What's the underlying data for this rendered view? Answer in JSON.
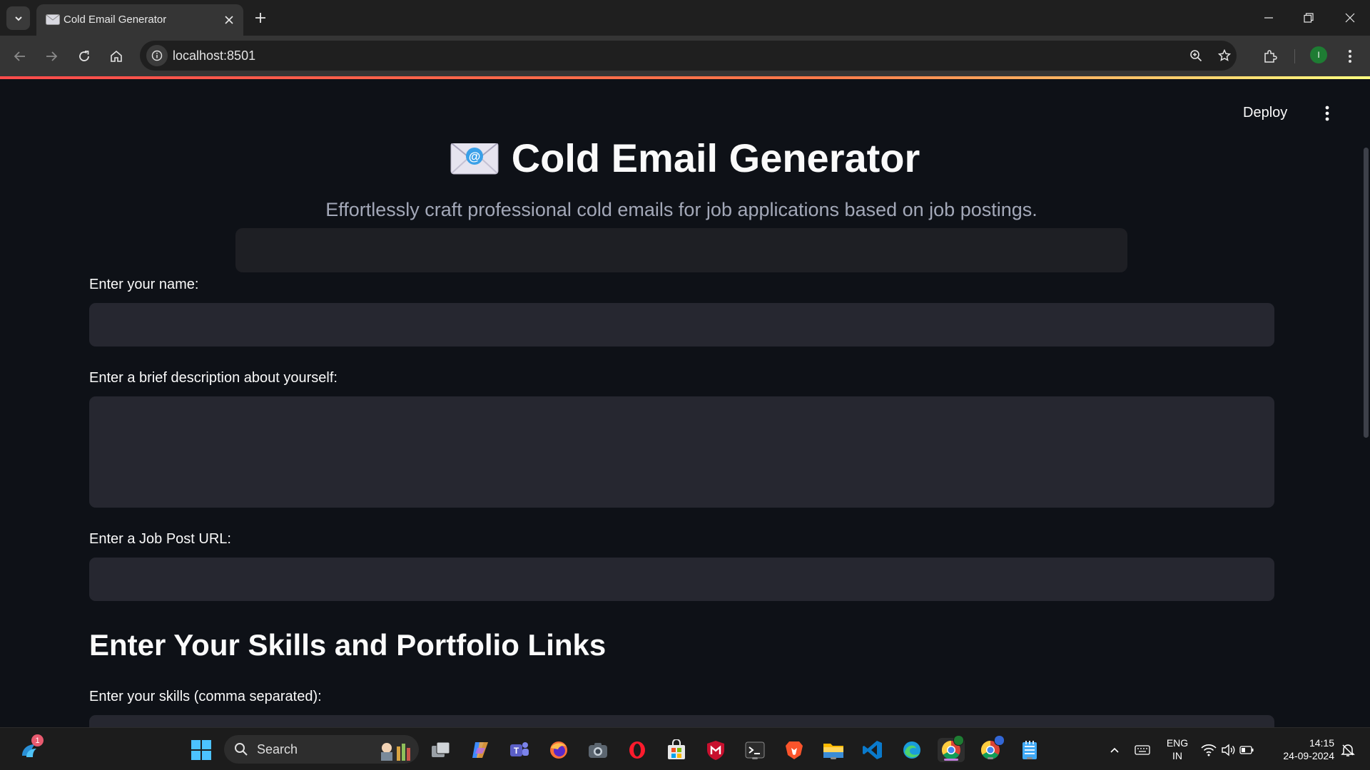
{
  "browser": {
    "tab_title": "Cold Email Generator",
    "url": "localhost:8501",
    "profile_initial": "I"
  },
  "app": {
    "deploy_label": "Deploy",
    "title": "Cold Email Generator",
    "subtitle": "Effortlessly craft professional cold emails for job applications based on job postings.",
    "name_label": "Enter your name:",
    "name_value": "",
    "description_label": "Enter a brief description about yourself:",
    "description_value": "",
    "job_url_label": "Enter a Job Post URL:",
    "job_url_value": "",
    "skills_heading": "Enter Your Skills and Portfolio Links",
    "skills_label": "Enter your skills (comma separated):"
  },
  "taskbar": {
    "search_label": "Search",
    "notification_count": "1",
    "lang_line1": "ENG",
    "lang_line2": "IN",
    "time": "14:15",
    "date": "24-09-2024"
  },
  "colors": {
    "app_bg": "#0e1117",
    "input_bg": "#262730",
    "accent": "#ff4b4b"
  }
}
